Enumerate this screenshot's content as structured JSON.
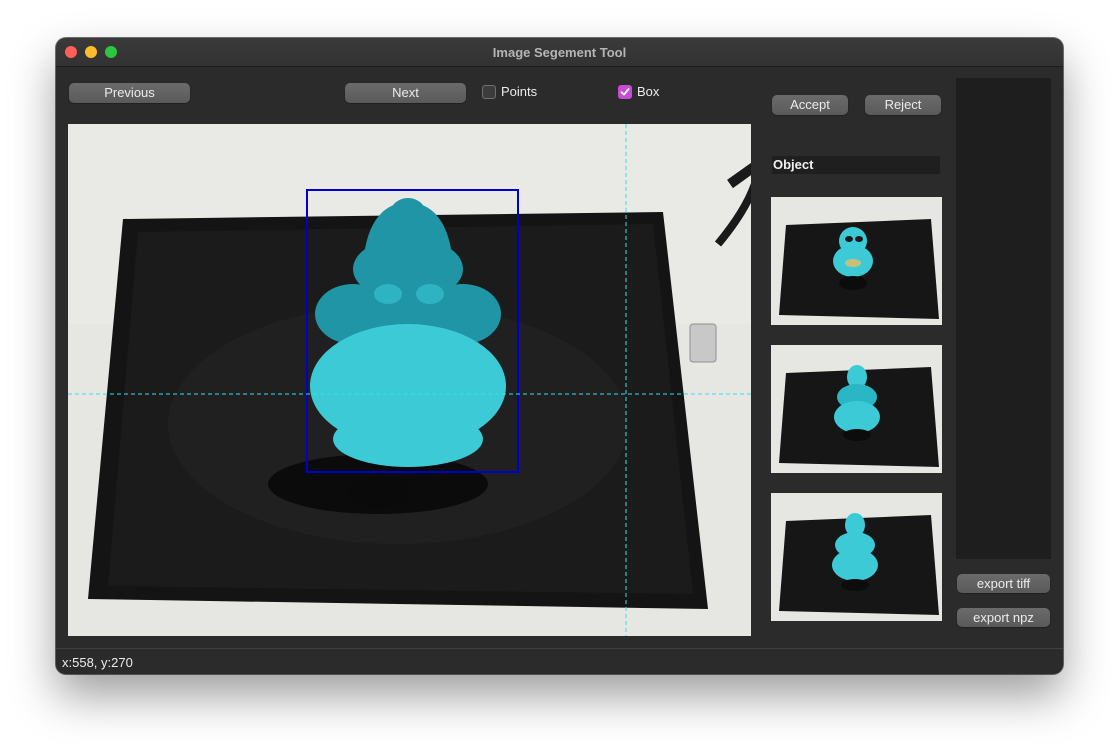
{
  "window": {
    "title": "Image Segement Tool"
  },
  "toolbar": {
    "previous_label": "Previous",
    "next_label": "Next",
    "points_label": "Points",
    "points_checked": false,
    "box_label": "Box",
    "box_checked": true
  },
  "actions": {
    "accept_label": "Accept",
    "reject_label": "Reject"
  },
  "objects": {
    "label": "Object",
    "thumbnail_count": 3
  },
  "export": {
    "tiff_label": "export tiff",
    "npz_label": "export npz"
  },
  "status": {
    "cursor_text": "x:558, y:270"
  },
  "colors": {
    "mask": "#3ccbd6",
    "mask_dark": "#1f95a6",
    "box": "#0000cc",
    "crosshair": "#34e0e8",
    "check_accent": "#c64cd4"
  }
}
